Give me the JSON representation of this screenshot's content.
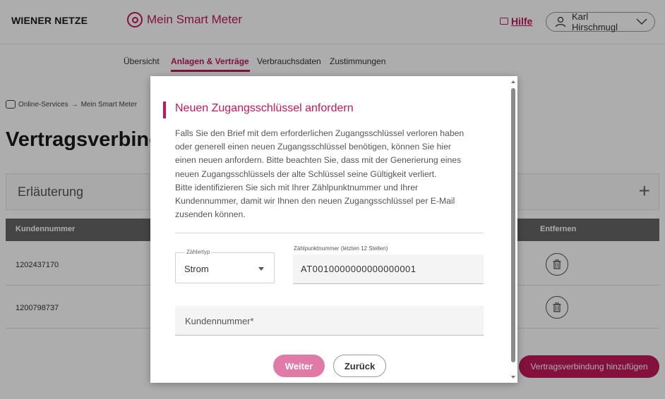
{
  "header": {
    "brand": "WIENER NETZE",
    "logo_icon": "wiener-netze-logo",
    "app_title": "Mein Smart Meter",
    "help_label": "Hilfe",
    "user_name": "Karl Hirschmugl"
  },
  "nav": {
    "tabs": [
      {
        "label": "Übersicht"
      },
      {
        "label": "Anlagen & Verträge",
        "active": true
      },
      {
        "label": "Verbrauchsdaten"
      },
      {
        "label": "Zustimmungen"
      }
    ]
  },
  "breadcrumb": {
    "items": [
      "Online-Services",
      "Mein Smart Meter"
    ],
    "separator": "→"
  },
  "page": {
    "title": "Vertragsverbindungen",
    "accordion_label": "Erläuterung",
    "table": {
      "headers": {
        "customer_number": "Kundennummer",
        "remove": "Entfernen"
      },
      "rows": [
        {
          "customer_number": "1202437170"
        },
        {
          "customer_number": "1200798737"
        }
      ]
    },
    "add_button_label": "Vertragsverbindung hinzufügen"
  },
  "modal": {
    "title": "Neuen Zugangsschlüssel anfordern",
    "body_lines": [
      "Falls Sie den Brief mit dem erforderlichen Zugangsschlüssel verloren haben",
      "oder generell einen neuen Zugangsschlüssel benötigen, können Sie hier",
      "einen neuen anfordern. Bitte beachten Sie, dass mit der Generierung eines",
      "neuen Zugangsschlüssels der alte Schlüssel seine Gültigkeit verliert.",
      "Bitte identifizieren Sie sich mit Ihrer Zählpunktnummer und Ihrer",
      "Kundennummer, damit wir Ihnen den neuen Zugangsschlüssel per E-Mail",
      "zusenden können."
    ],
    "meter_type": {
      "label": "Zählertyp",
      "value": "Strom"
    },
    "metering_point": {
      "label": "Zählpunktnummer (letzten 12 Stellen)",
      "value": "AT0010000000000000001"
    },
    "customer_number_field": {
      "placeholder": "Kundennummer*"
    },
    "next_label": "Weiter",
    "back_label": "Zurück"
  },
  "colors": {
    "brand": "#c2185b",
    "brand_light": "#e07aa6",
    "table_header": "#666666"
  }
}
